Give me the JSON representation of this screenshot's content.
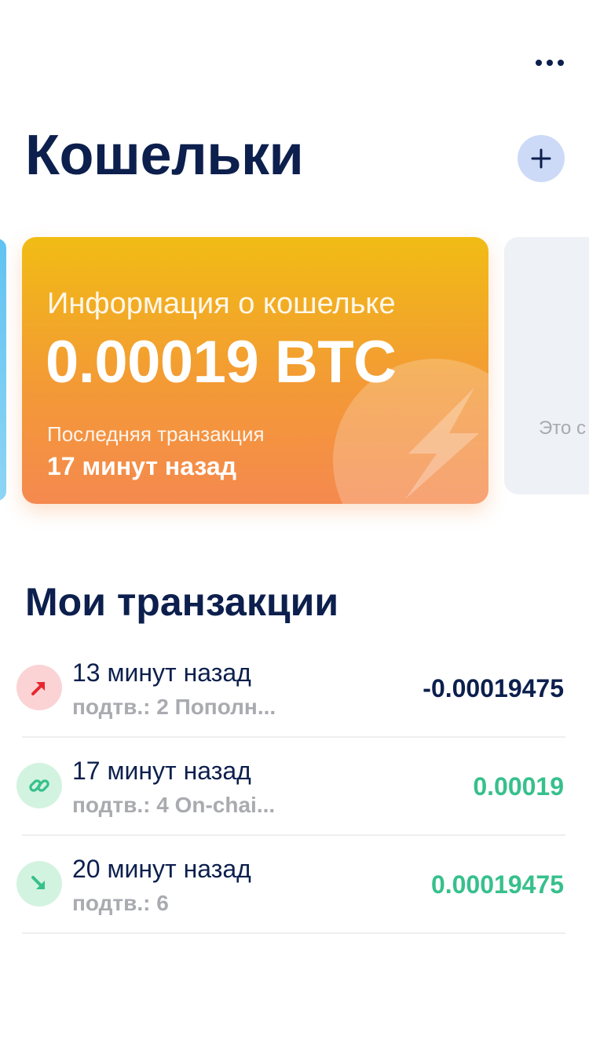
{
  "header": {
    "title": "Кошельки",
    "more_icon": "more-horizontal-icon",
    "add_icon": "plus-icon"
  },
  "wallet_card": {
    "label": "Информация о кошельке",
    "balance": "0.00019 BTC",
    "last_tx_label": "Последняя транзакция",
    "last_tx_value": "17 минут назад",
    "icon": "lightning-bolt-icon",
    "colors": {
      "gradient_top": "#f1bc14",
      "gradient_bottom": "#f5894f"
    }
  },
  "next_card": {
    "peek_text": "Это с"
  },
  "transactions": {
    "title": "Мои транзакции",
    "items": [
      {
        "time": "13 минут назад",
        "memo": "подтв.: 2 Пополн...",
        "amount": "-0.00019475",
        "direction": "outgoing",
        "icon": "arrow-up-right-icon",
        "icon_color": "#e8262e",
        "icon_bg": "#fbd3d4",
        "amount_color": "#0c1f4d"
      },
      {
        "time": "17 минут назад",
        "memo": "подтв.: 4 On-chai...",
        "amount": "0.00019",
        "direction": "incoming",
        "icon": "link-icon",
        "icon_color": "#37c08c",
        "icon_bg": "#d3f3e1",
        "amount_color": "#37c08c"
      },
      {
        "time": "20 минут назад",
        "memo": "подтв.: 6",
        "amount": "0.00019475",
        "direction": "incoming",
        "icon": "arrow-down-right-icon",
        "icon_color": "#37c08c",
        "icon_bg": "#d3f3e1",
        "amount_color": "#37c08c"
      }
    ]
  },
  "colors": {
    "primary_text": "#0c1f4d",
    "secondary_text": "#a9abb0",
    "accent_button_bg": "#ccdaf7",
    "positive": "#37c08c",
    "negative": "#e8262e"
  }
}
